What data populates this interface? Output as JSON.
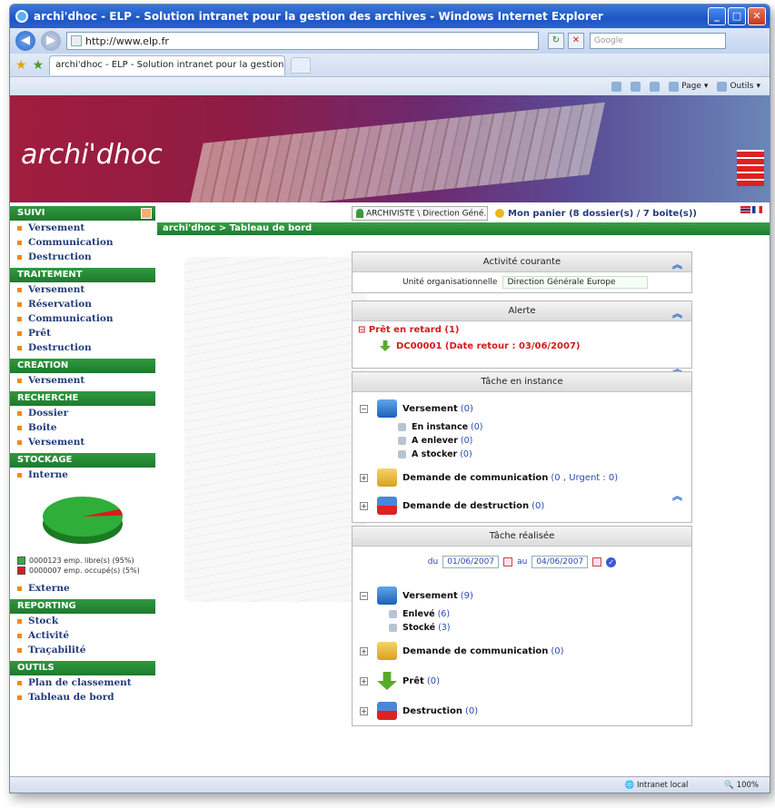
{
  "browser": {
    "title": "archi'dhoc - ELP - Solution intranet pour la gestion des archives - Windows Internet Explorer",
    "url": "http://www.elp.fr",
    "tab_title": "archi'dhoc - ELP - Solution intranet pour la gestion des...",
    "search_placeholder": "Google",
    "cmd_page": "Page",
    "cmd_tools": "Outils",
    "status_zone": "Intranet local",
    "zoom": "100%"
  },
  "banner": {
    "logo": "archi'dhoc"
  },
  "topbar": {
    "user": "ARCHIVISTE \\ Direction Géné...",
    "basket": "Mon panier (8 dossier(s) / 7 boite(s))",
    "breadcrumb": "archi'dhoc > Tableau de bord"
  },
  "sidebar": {
    "suivi": {
      "title": "SUIVI",
      "items": [
        "Versement",
        "Communication",
        "Destruction"
      ]
    },
    "traitement": {
      "title": "TRAITEMENT",
      "items": [
        "Versement",
        "Réservation",
        "Communication",
        "Prêt",
        "Destruction"
      ]
    },
    "creation": {
      "title": "CREATION",
      "items": [
        "Versement"
      ]
    },
    "recherche": {
      "title": "RECHERCHE",
      "items": [
        "Dossier",
        "Boite",
        "Versement"
      ]
    },
    "stockage": {
      "title": "STOCKAGE",
      "interne": "Interne",
      "externe": "Externe",
      "legend_free": "0000123 emp. libre(s) (95%)",
      "legend_used": "0000007 emp. occupé(s) (5%)",
      "free_pct": 95,
      "used_pct": 5,
      "free_color": "#2fae3a",
      "used_color": "#d81c1c"
    },
    "reporting": {
      "title": "REPORTING",
      "items": [
        "Stock",
        "Activité",
        "Traçabilité"
      ]
    },
    "outils": {
      "title": "OUTILS",
      "items": [
        "Plan de classement",
        "Tableau de bord"
      ]
    }
  },
  "panels": {
    "activite": {
      "title": "Activité courante",
      "unit_label": "Unité organisationnelle",
      "unit_value": "Direction Générale Europe"
    },
    "alerte": {
      "title": "Alerte",
      "group": "Prêt en retard (1)",
      "item": "DC00001 (Date retour : 03/06/2007)"
    },
    "instance": {
      "title": "Tâche en instance",
      "versement": "Versement",
      "versement_count": "(0)",
      "en_instance": "En instance",
      "en_instance_count": "(0)",
      "a_enlever": "A enlever",
      "a_enlever_count": "(0)",
      "a_stocker": "A stocker",
      "a_stocker_count": "(0)",
      "communication": "Demande de communication",
      "communication_count": "(0 , Urgent : 0)",
      "destruction": "Demande de destruction",
      "destruction_count": "(0)"
    },
    "realisee": {
      "title": "Tâche réalisée",
      "du": "du",
      "date_from": "01/06/2007",
      "au": "au",
      "date_to": "04/06/2007",
      "versement": "Versement",
      "versement_count": "(9)",
      "enleve": "Enlevé",
      "enleve_count": "(6)",
      "stocke": "Stocké",
      "stocke_count": "(3)",
      "communication": "Demande de communication",
      "communication_count": "(0)",
      "pret": "Prêt",
      "pret_count": "(0)",
      "destruction": "Destruction",
      "destruction_count": "(0)"
    }
  }
}
